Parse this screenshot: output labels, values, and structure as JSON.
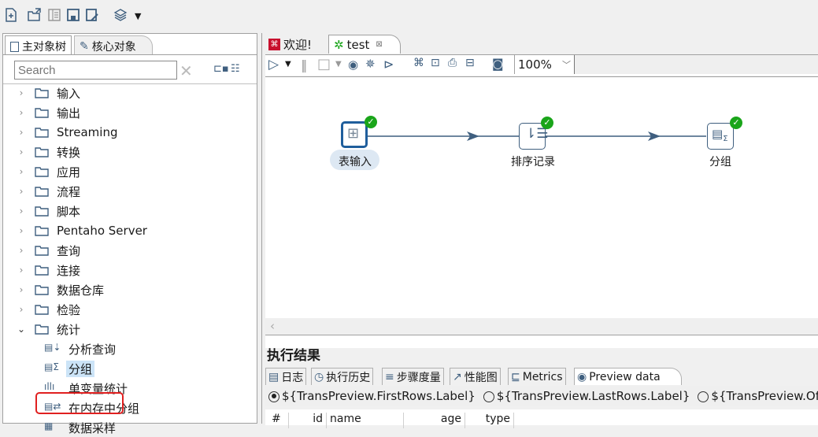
{
  "toolbar": {
    "icons": [
      "new-file-icon",
      "open-file-icon",
      "explore-repository-icon",
      "save-icon",
      "save-as-icon",
      "perspective-layers-icon"
    ]
  },
  "left_panel": {
    "tabs": [
      {
        "label": "主对象树",
        "icon": "search-document-icon",
        "active": false
      },
      {
        "label": "核心对象",
        "icon": "pencil-icon",
        "active": true
      }
    ],
    "search": {
      "placeholder": "Search",
      "value": ""
    },
    "tree": [
      {
        "label": "输入",
        "expanded": false
      },
      {
        "label": "输出",
        "expanded": false
      },
      {
        "label": "Streaming",
        "expanded": false
      },
      {
        "label": "转换",
        "expanded": false
      },
      {
        "label": "应用",
        "expanded": false
      },
      {
        "label": "流程",
        "expanded": false
      },
      {
        "label": "脚本",
        "expanded": false
      },
      {
        "label": "Pentaho Server",
        "expanded": false
      },
      {
        "label": "查询",
        "expanded": false
      },
      {
        "label": "连接",
        "expanded": false
      },
      {
        "label": "数据仓库",
        "expanded": false
      },
      {
        "label": "检验",
        "expanded": false
      },
      {
        "label": "统计",
        "expanded": true
      }
    ],
    "leaves": [
      {
        "label": "分析查询",
        "icon": "analytic-query-icon"
      },
      {
        "label": "分组",
        "icon": "group-by-icon",
        "selected": true
      },
      {
        "label": "单变量统计",
        "icon": "univariate-stats-icon"
      },
      {
        "label": "在内存中分组",
        "icon": "memory-group-by-icon"
      },
      {
        "label": "数据采样",
        "icon": "sampling-icon"
      }
    ]
  },
  "editor": {
    "tabs": [
      {
        "label": "欢迎!",
        "icon": "pentaho-welcome-icon",
        "active": false
      },
      {
        "label": "test",
        "icon": "transformation-icon",
        "active": true,
        "closable": true
      }
    ],
    "zoom": "100%",
    "steps": [
      {
        "label": "表输入",
        "icon": "table-input-icon",
        "status": "success",
        "selected": true
      },
      {
        "label": "排序记录",
        "icon": "sort-rows-icon",
        "status": "success"
      },
      {
        "label": "分组",
        "icon": "group-by-icon",
        "status": "success"
      }
    ]
  },
  "results": {
    "title": "执行结果",
    "tabs": [
      {
        "label": "日志",
        "icon": "log-icon"
      },
      {
        "label": "执行历史",
        "icon": "history-icon"
      },
      {
        "label": "步骤度量",
        "icon": "step-metrics-icon"
      },
      {
        "label": "性能图",
        "icon": "performance-chart-icon"
      },
      {
        "label": "Metrics",
        "icon": "metrics-icon"
      },
      {
        "label": "Preview data",
        "icon": "eye-icon",
        "active": true
      }
    ],
    "radio_options": [
      {
        "label": "${TransPreview.FirstRows.Label}",
        "checked": true
      },
      {
        "label": "${TransPreview.LastRows.Label}",
        "checked": false
      },
      {
        "label": "${TransPreview.Off.Label}",
        "checked": false
      }
    ],
    "columns": [
      "#",
      "id",
      "name",
      "age",
      "type"
    ]
  }
}
